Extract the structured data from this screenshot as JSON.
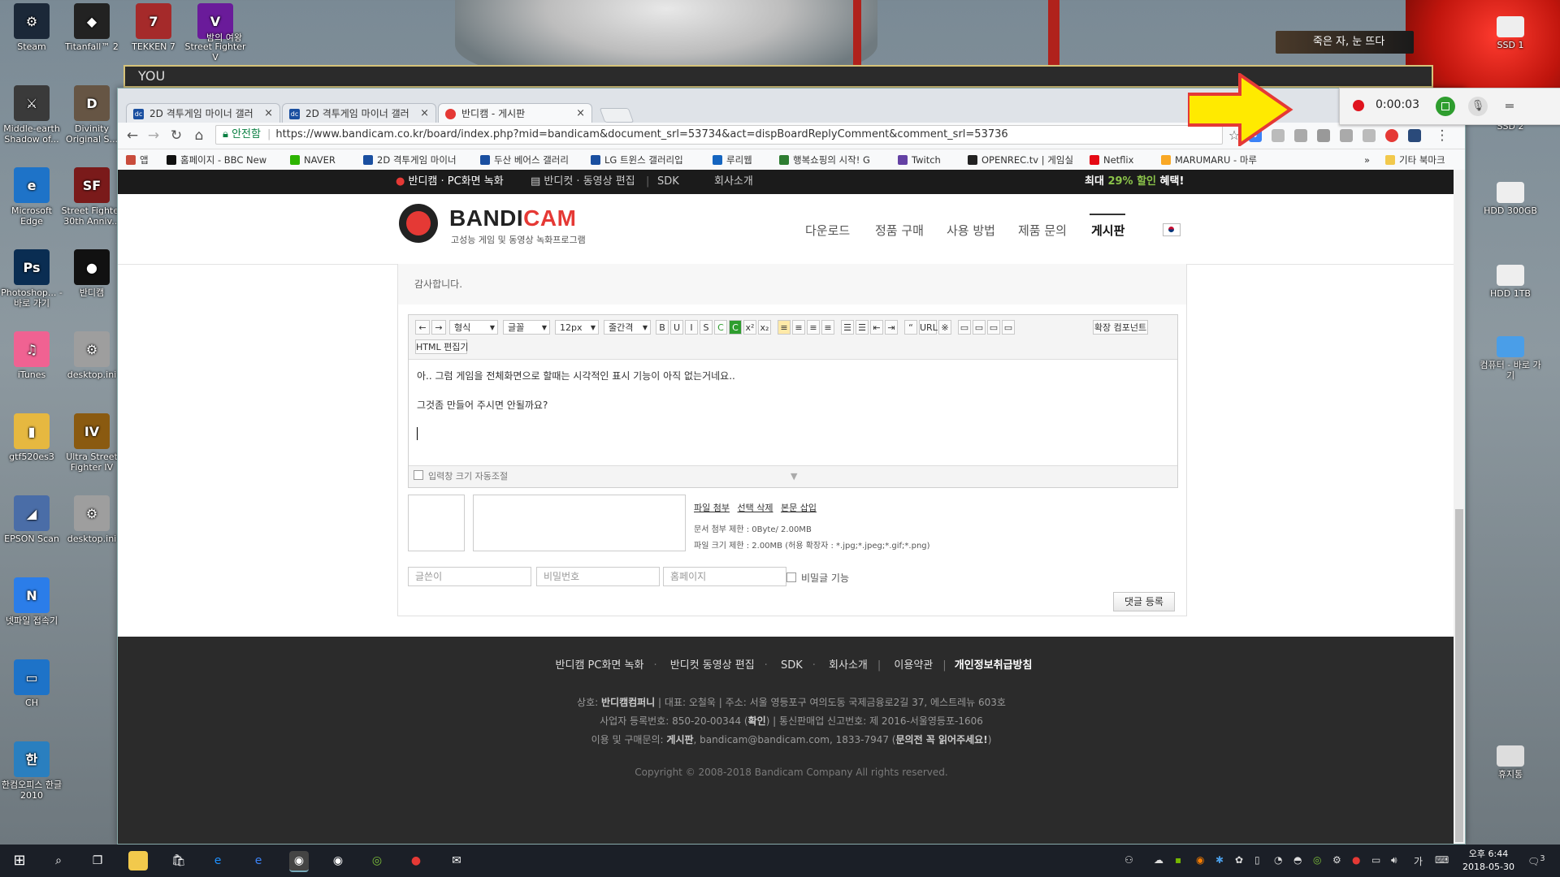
{
  "desktop": {
    "icons_left": [
      {
        "label": "Steam",
        "color": "#1b2838",
        "glyph": "⚙"
      },
      {
        "label": "Middle-earth Shadow of...",
        "color": "#3a3a3a",
        "glyph": "⚔"
      },
      {
        "label": "Microsoft Edge",
        "color": "#1e73c8",
        "glyph": "e"
      },
      {
        "label": "Photoshop... - 바로 가기",
        "color": "#0a2d52",
        "glyph": "Ps"
      },
      {
        "label": "iTunes",
        "color": "#f06292",
        "glyph": "♫"
      },
      {
        "label": "gtf520es3",
        "color": "#e6b840",
        "glyph": "▮"
      },
      {
        "label": "EPSON Scan",
        "color": "#4a6da7",
        "glyph": "◢"
      },
      {
        "label": "넷파일 접속기",
        "color": "#2b7de9",
        "glyph": "N"
      },
      {
        "label": "CH",
        "color": "#1e73c8",
        "glyph": "▭"
      },
      {
        "label": "한컴오피스 한글 2010",
        "color": "#2a7fbf",
        "glyph": "한"
      }
    ],
    "icons_col2": [
      {
        "label": "Titanfall™ 2",
        "color": "#222",
        "glyph": "◆"
      },
      {
        "label": "Divinity Original S...",
        "color": "#665544",
        "glyph": "D"
      },
      {
        "label": "Street Fighter 30th Anniv...",
        "color": "#7a1a1a",
        "glyph": "SF"
      },
      {
        "label": "반디캠",
        "color": "#111",
        "glyph": "●"
      },
      {
        "label": "desktop.ini",
        "color": "#9e9e9e",
        "glyph": "⚙"
      },
      {
        "label": "Ultra Street Fighter IV",
        "color": "#8a5a10",
        "glyph": "IV"
      },
      {
        "label": "desktop.ini",
        "color": "#9e9e9e",
        "glyph": "⚙"
      }
    ],
    "icons_top": [
      {
        "label": "TEKKEN 7",
        "color": "#a52a2a",
        "glyph": "7"
      },
      {
        "label": "Street Fighter V",
        "color": "#6a1b9a",
        "glyph": "V"
      }
    ],
    "icons_right": [
      {
        "label": "SSD 1",
        "color": "#eee"
      },
      {
        "label": "SSD 2",
        "color": "#eee"
      },
      {
        "label": "HDD 300GB",
        "color": "#eee"
      },
      {
        "label": "HDD 1TB",
        "color": "#eee"
      },
      {
        "label": "컴퓨터 - 바로 가기",
        "color": "#4a9ee8"
      },
      {
        "label": "휴지통",
        "color": "#ddd"
      }
    ],
    "game_overlay": "YOU",
    "game_banner": "죽은 자, 눈 뜨다",
    "tooltip": "밤의 여왕"
  },
  "browser": {
    "tabs": [
      {
        "label": "2D 격투게임 마이너 갤러",
        "fav": "dc"
      },
      {
        "label": "2D 격투게임 마이너 갤러",
        "fav": "dc"
      },
      {
        "label": "반디캠 - 게시판",
        "fav": ""
      }
    ],
    "tab_close": "×",
    "address": {
      "secure_label": "안전함",
      "url": "https://www.bandicam.co.kr/board/index.php?mid=bandicam&document_srl=53734&act=dispBoardReplyComment&comment_srl=53736"
    },
    "nav": {
      "back": "←",
      "forward": "→",
      "reload": "↻",
      "home": "⌂"
    },
    "star": "☆",
    "menu_dots": "⋮",
    "bookmarks": [
      {
        "label": "앱",
        "color": "#c94c3c"
      },
      {
        "label": "홈페이지 - BBC New",
        "color": "#111"
      },
      {
        "label": "NAVER",
        "color": "#2db400"
      },
      {
        "label": "2D 격투게임 마이너",
        "color": "#1a4fa0"
      },
      {
        "label": "두산 베어스 갤러리",
        "color": "#1a4fa0"
      },
      {
        "label": "LG 트윈스 갤러리입",
        "color": "#1a4fa0"
      },
      {
        "label": "루리웹",
        "color": "#1565c0"
      },
      {
        "label": "행복쇼핑의 시작! G",
        "color": "#2e7d32"
      },
      {
        "label": "Twitch",
        "color": "#6441a4"
      },
      {
        "label": "OPENREC.tv | 게임실",
        "color": "#222"
      },
      {
        "label": "Netflix",
        "color": "#e50914"
      },
      {
        "label": "MARUMARU - 마루",
        "color": "#f9a825"
      }
    ],
    "bookmarks_more": "»",
    "bookmarks_other": "기타 북마크"
  },
  "site": {
    "topbar": {
      "item1": "반디캠 · PC화면 녹화",
      "item2": "반디컷 · 동영상 편집",
      "item3": "SDK",
      "item4": "회사소개",
      "promo_pre": "최대 ",
      "promo_pct": "29% 할인",
      "promo_post": " 혜택!"
    },
    "logo": {
      "bandi": "BANDI",
      "cam": "CAM",
      "sub": "고성능 게임 및 동영상 녹화프로그램"
    },
    "menu": [
      "다운로드",
      "정품 구매",
      "사용 방법",
      "제품 문의",
      "게시판"
    ],
    "thanks": "감사합니다.",
    "editor": {
      "toolbar_selects": [
        "형식",
        "글꼴",
        "12px",
        "줄간격"
      ],
      "toolbar_btns": [
        "B",
        "U",
        "I",
        "S",
        "C",
        "C",
        "x²",
        "x₂",
        "≡",
        "≡",
        "≡",
        "≡",
        "☰",
        "☰",
        "⇤",
        "⇥",
        "“",
        "URL",
        "※",
        "▭",
        "▭",
        "▭",
        "▭"
      ],
      "expand_btn": "확장 컴포넌트",
      "html_btn": "HTML 편집기",
      "line1": "아.. 그럼 게임을 전체화면으로 할때는 시각적인 표시 기능이 아직 없는거네요..",
      "line2": "그것좀 만들어 주시면 안될까요?",
      "auto_resize": "입력창 크기 자동조절"
    },
    "attach": {
      "links": [
        "파일 첨부",
        "선택 삭제",
        "본문 삽입"
      ],
      "limit1": "문서 첨부 제한 : 0Byte/ 2.00MB",
      "limit2": "파일 크기 제한 : 2.00MB (허용 확장자 : *.jpg;*.jpeg;*.gif;*.png)"
    },
    "fields": {
      "author": "글쓴이",
      "password": "비밀번호",
      "homepage": "홈페이지",
      "secret": "비밀글 기능"
    },
    "submit": "댓글 등록",
    "footer": {
      "links": [
        "반디캠 PC화면 녹화",
        "반디컷 동영상 편집",
        "SDK",
        "회사소개",
        "이용약관",
        "개인정보취급방침"
      ],
      "l1_a": "상호: ",
      "l1_b": "반디캠컴퍼니",
      "l1_c": " | 대표: 오철욱 | 주소: 서울 영등포구 여의도동 국제금융로2길 37, 에스트레뉴 603호",
      "l2_a": "사업자 등록번호: 850-20-00344 (",
      "l2_b": "확인",
      "l2_c": ") | 통신판매업 신고번호: 제 2016-서울영등포-1606",
      "l3_a": "이용 및 구매문의: ",
      "l3_b": "게시판",
      "l3_c": ", bandicam@bandicam.com, 1833-7947 (",
      "l3_d": "문의전 꼭 읽어주세요!",
      "l3_e": ")",
      "copyright": "Copyright © 2008-2018 Bandicam Company All rights reserved."
    }
  },
  "recorder": {
    "time": "0:00:03",
    "menu": "═"
  },
  "taskbar": {
    "clock_time": "오후 6:44",
    "clock_date": "2018-05-30",
    "ime": "가",
    "notif": "3"
  },
  "colors": {
    "accent": "#e53935",
    "bandi_green": "#8bc34a",
    "arrow_fill": "#ffea00",
    "arrow_stroke": "#e53935"
  }
}
